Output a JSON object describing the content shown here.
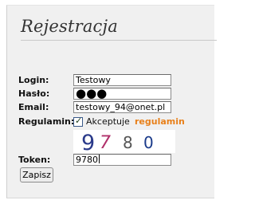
{
  "form": {
    "title": "Rejestracja",
    "fields": {
      "login": {
        "label": "Login:",
        "value": "Testowy"
      },
      "password": {
        "label": "Hasło:",
        "value": "●●●"
      },
      "email": {
        "label": "Email:",
        "value": "testowy_94@onet.pl"
      },
      "terms": {
        "label": "Regulamin:",
        "checked": true,
        "text": "Akceptuje",
        "link_text": "regulamin",
        "link_color": "#e8801a"
      },
      "captcha": {
        "digits": [
          {
            "char": "9",
            "color": "#2a3a8a"
          },
          {
            "char": "7",
            "color": "#b0306a"
          },
          {
            "char": "8",
            "color": "#555555"
          },
          {
            "char": "0",
            "color": "#1a3a8a"
          }
        ]
      },
      "token": {
        "label": "Token:",
        "value": "9780"
      }
    },
    "submit_label": "Zapisz"
  }
}
